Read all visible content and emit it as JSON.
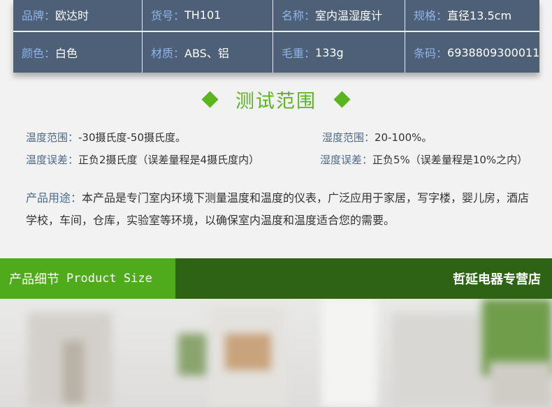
{
  "specs": {
    "rows": [
      [
        {
          "key": "品牌：",
          "value": "欧达时"
        },
        {
          "key": "货号：",
          "value": "TH101"
        },
        {
          "key": "名称：",
          "value": "室内温湿度计"
        },
        {
          "key": "规格：",
          "value": "直径13.5cm"
        }
      ],
      [
        {
          "key": "颜色：",
          "value": "白色"
        },
        {
          "key": "材质：",
          "value": "ABS、铝"
        },
        {
          "key": "毛重：",
          "value": "133g"
        },
        {
          "key": "条码：",
          "value": "6938809300011"
        }
      ]
    ]
  },
  "test_range": {
    "title": "测试范围",
    "temp_range_label": "温度范围：",
    "temp_range_value": "-30摄氏度-50摄氏度。",
    "humidity_range_label": "湿度范围：",
    "humidity_range_value": "20-100%。",
    "temp_error_label": "温度误差：",
    "temp_error_value": "正负2摄氏度（误差量程是4摄氏度内）",
    "humidity_error_label": "湿度误差：",
    "humidity_error_value": "正负5%（误差量程是10%之内）",
    "usage_label": "产品用途：",
    "usage_value": "本产品是专门室内环境下测量温度和温度的仪表，广泛应用于家居，写字楼，婴儿房，酒店学校，车间，仓库，实验室等环境，以确保室内温度和温度适合您的需要。"
  },
  "banner": {
    "left_cn": "产品细节",
    "left_en": "Product Size",
    "right": "哲延电器专营店"
  },
  "colors": {
    "table_bg": "#4d6077",
    "accent_green": "#5ab51f",
    "banner_light": "#4faa1c",
    "banner_dark": "#2e6316"
  }
}
